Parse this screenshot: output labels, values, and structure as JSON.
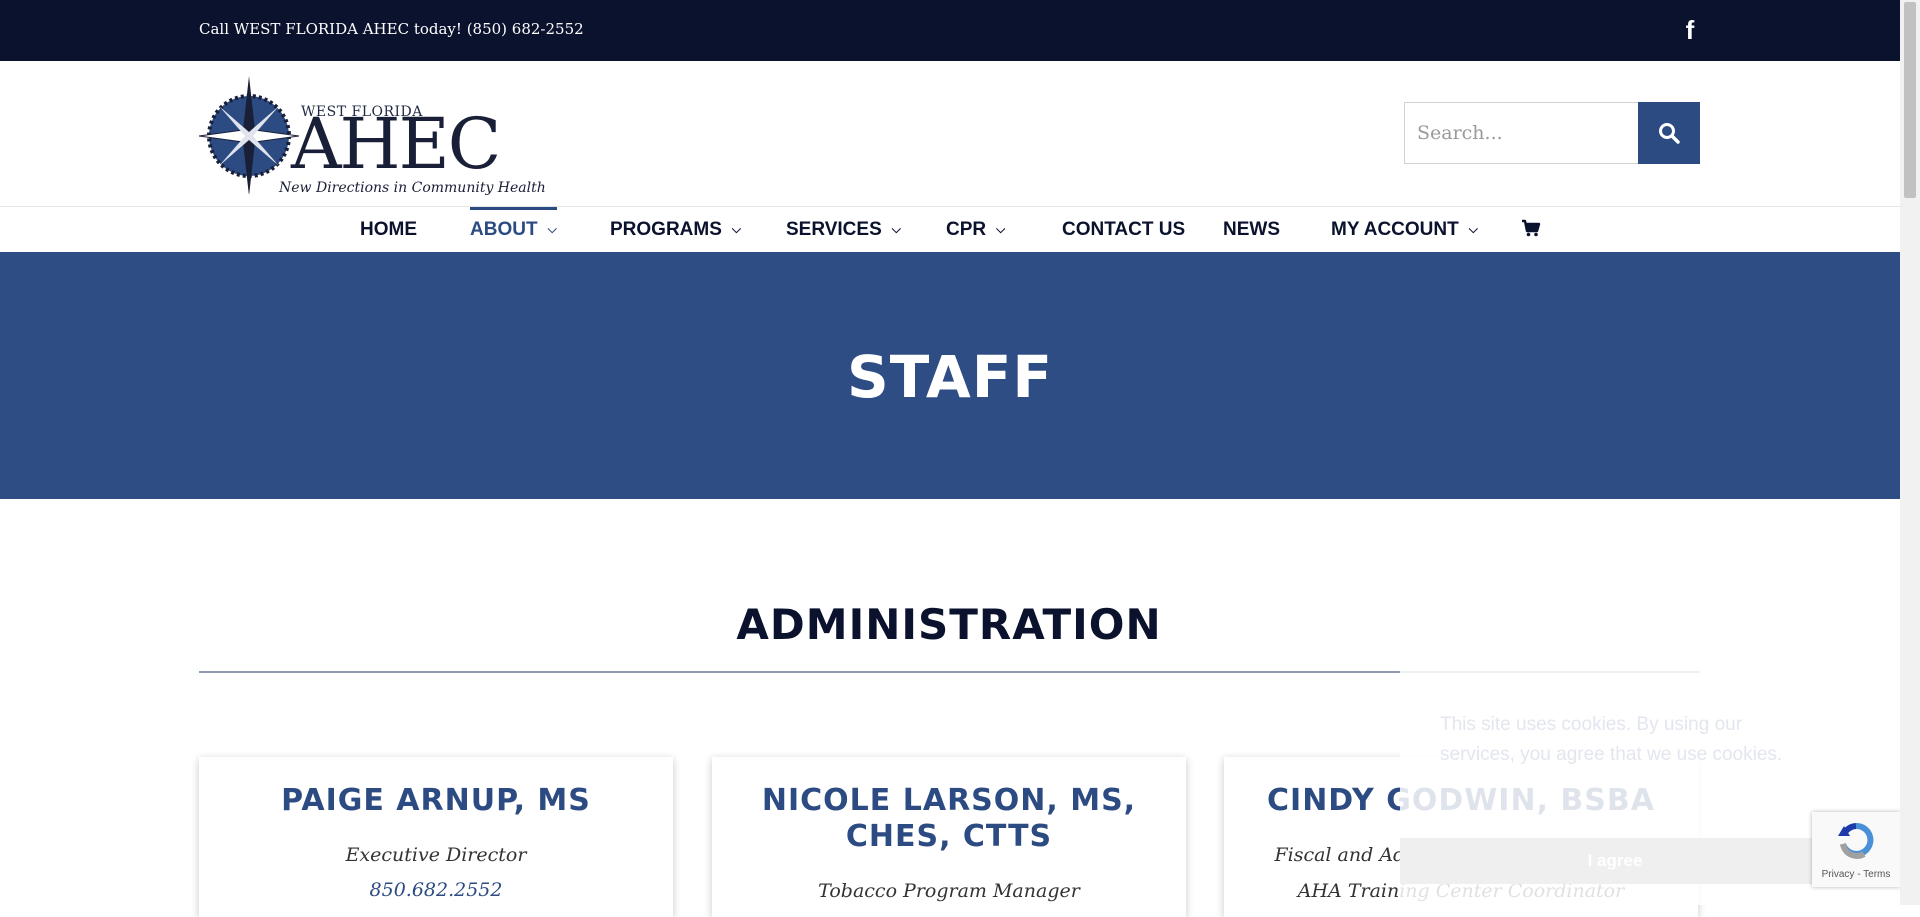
{
  "topbar": {
    "call_text": "Call WEST FLORIDA AHEC today! (850) 682-2552",
    "facebook_glyph": "f"
  },
  "logo": {
    "small_text": "WEST FLORIDA",
    "big_text": "AHEC",
    "tagline": "New Directions in Community Health"
  },
  "search": {
    "placeholder": "Search..."
  },
  "nav": {
    "items": [
      {
        "label": "HOME"
      },
      {
        "label": "ABOUT",
        "active": true
      },
      {
        "label": "PROGRAMS"
      },
      {
        "label": "SERVICES"
      },
      {
        "label": "CPR"
      },
      {
        "label": "CONTACT US"
      },
      {
        "label": "NEWS"
      },
      {
        "label": "MY ACCOUNT"
      }
    ]
  },
  "hero": {
    "title": "STAFF"
  },
  "section": {
    "title": "ADMINISTRATION"
  },
  "cards": [
    {
      "name": "PAIGE ARNUP, MS",
      "role": "Executive Director",
      "phone": "850.682.2552"
    },
    {
      "name_line1": "NICOLE LARSON, MS,",
      "name_line2": "CHES, CTTS",
      "role": "Tobacco Program Manager"
    },
    {
      "name": "CINDY GODWIN, BSBA",
      "role_line1": "Fiscal and Administrative Coordinator,",
      "role_line2": "AHA Training Center Coordinator"
    }
  ],
  "cookie": {
    "message": "This site uses cookies. By using our services, you agree that we use cookies.",
    "button": "I agree"
  },
  "recaptcha": {
    "links": "Privacy - Terms"
  },
  "colors": {
    "topbar_bg": "#0b122d",
    "brand_blue": "#2c4b82",
    "hero_bg": "#2e4d84",
    "text_dark": "#0b122d"
  }
}
